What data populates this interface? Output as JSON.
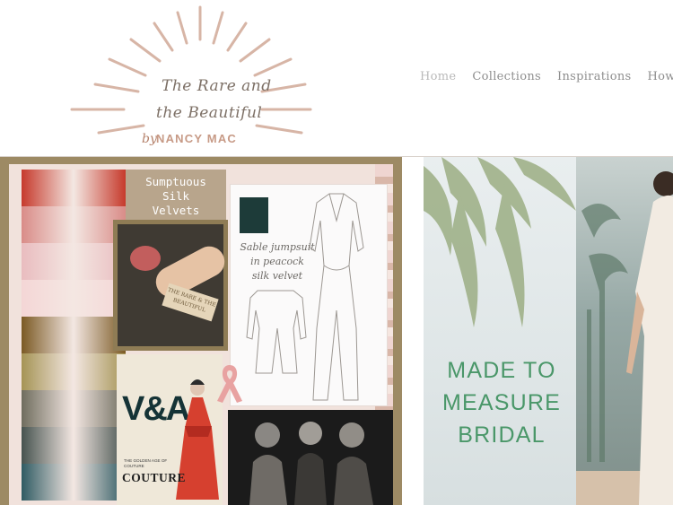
{
  "logo": {
    "line1": "The Rare and",
    "line2": "the Beautiful",
    "by": "by",
    "brand": "NANCY MAC",
    "accent_color": "#c9a48f"
  },
  "nav": {
    "items": [
      {
        "label": "Home",
        "active": true
      },
      {
        "label": "Collections",
        "active": false
      },
      {
        "label": "Inspirations",
        "active": false
      },
      {
        "label": "How to o",
        "active": false
      }
    ]
  },
  "moodboard": {
    "banner": [
      "Sumptuous",
      "Silk",
      "Velvets"
    ],
    "tag": "THE RARE & THE BEAUTIFUL",
    "sketch_note": [
      "Sable jumpsuit",
      "in peacock",
      "silk velvet"
    ],
    "va_logo": "V&A",
    "va_subtitle": "THE GOLDEN AGE OF COUTURE",
    "va_title": "COUTURE",
    "swatch_colors": [
      "#c63a2c",
      "#d98c88",
      "#e9bcbf",
      "#f4d6d6",
      "#7b5a24",
      "#a59455",
      "#6f6d5e",
      "#46534f",
      "#2f5b63"
    ]
  },
  "hero": {
    "title_lines": [
      "MADE TO",
      "MEASURE",
      "BRIDAL"
    ],
    "title_color": "#4a9769"
  }
}
